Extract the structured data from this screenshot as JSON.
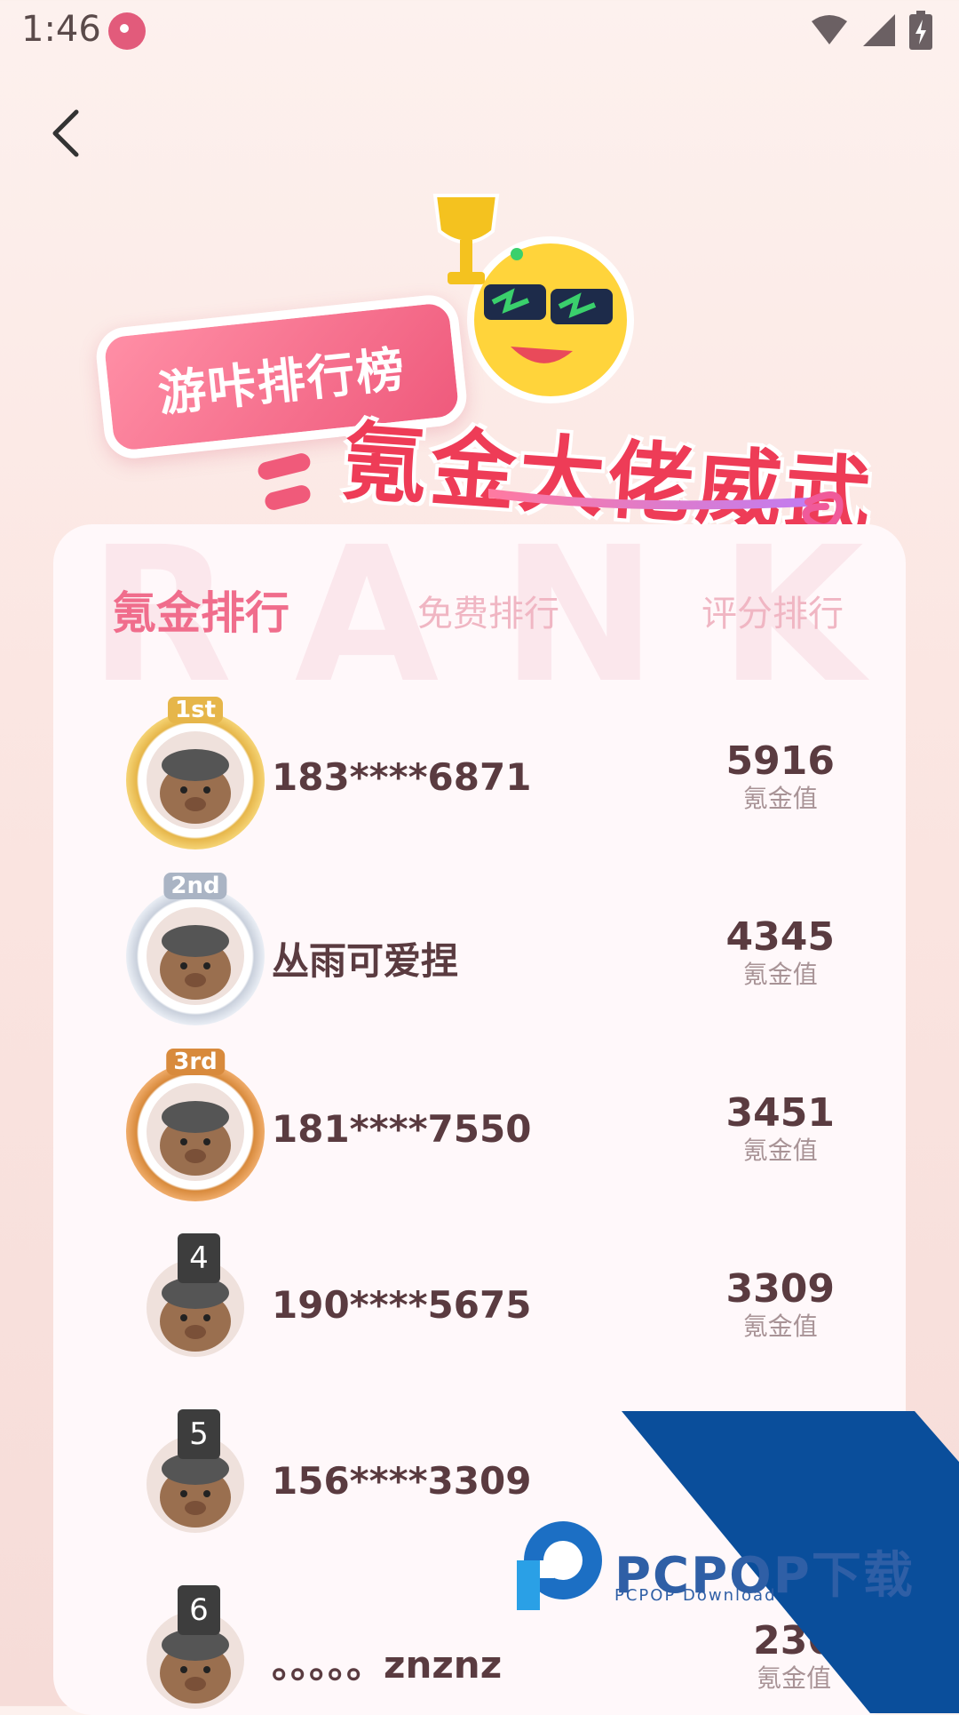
{
  "status_bar": {
    "time": "1:46"
  },
  "banner": {
    "title": "游咔排行榜",
    "subtitle": "氪金大佬威武"
  },
  "panel": {
    "background_word": "RANK",
    "tabs": [
      {
        "label": "氪金排行",
        "active": true
      },
      {
        "label": "免费排行",
        "active": false
      },
      {
        "label": "评分排行",
        "active": false
      }
    ]
  },
  "ranking": [
    {
      "rank": 1,
      "medal": "1st",
      "name": "183****6871",
      "value": "5916",
      "unit": "氪金值"
    },
    {
      "rank": 2,
      "medal": "2nd",
      "name": "丛雨可爱捏",
      "value": "4345",
      "unit": "氪金值"
    },
    {
      "rank": 3,
      "medal": "3rd",
      "name": "181****7550",
      "value": "3451",
      "unit": "氪金值"
    },
    {
      "rank": 4,
      "badge": "4",
      "name": "190****5675",
      "value": "3309",
      "unit": "氪金值"
    },
    {
      "rank": 5,
      "badge": "5",
      "name": "156****3309",
      "value": "",
      "unit": ""
    },
    {
      "rank": 6,
      "badge": "6",
      "name": "。。。。。znznz",
      "value": "236",
      "unit": "氪金值"
    }
  ],
  "watermark": {
    "brand": "PCPOP下载",
    "sub": "PCPOP Download"
  },
  "colors": {
    "accent": "#f06d8c",
    "name_text": "#5a3b40",
    "gold": "#e6b64a",
    "silver": "#c9d0dc",
    "bronze": "#d88a3c"
  }
}
